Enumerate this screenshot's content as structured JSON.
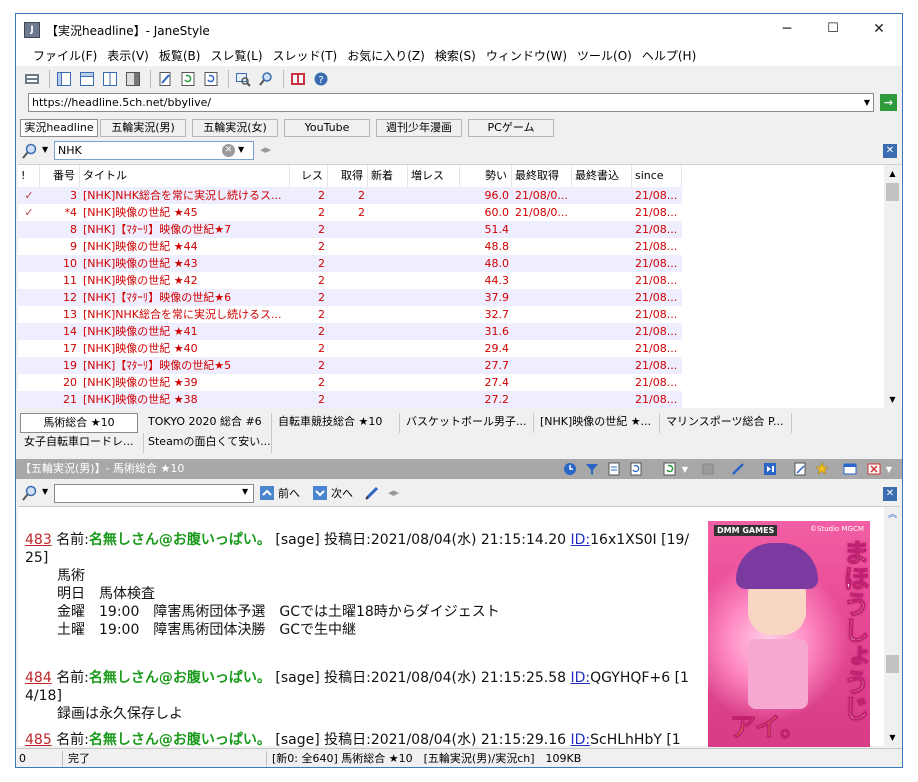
{
  "window": {
    "title": "【実況headline】- JaneStyle",
    "min": "─",
    "max": "☐",
    "close": "✕"
  },
  "menu": [
    "ファイル(F)",
    "表示(V)",
    "板覧(B)",
    "スレ覧(L)",
    "スレッド(T)",
    "お気に入り(Z)",
    "検索(S)",
    "ウィンドウ(W)",
    "ツール(O)",
    "ヘルプ(H)"
  ],
  "address": {
    "url": "https://headline.5ch.net/bbylive/",
    "go": "→"
  },
  "board_tabs": [
    {
      "label": "実況headline",
      "selected": true
    },
    {
      "label": "五輪実況(男)",
      "selected": false
    },
    {
      "label": "五輪実況(女)",
      "selected": false
    },
    {
      "label": "YouTube",
      "selected": false
    },
    {
      "label": "週刊少年漫画",
      "selected": false
    },
    {
      "label": "PCゲーム",
      "selected": false
    }
  ],
  "list_search": {
    "value": "NHK"
  },
  "list": {
    "headers": [
      "!",
      "番号",
      "タイトル",
      "レス",
      "取得",
      "新着",
      "増レス",
      "勢い",
      "最終取得",
      "最終書込",
      "since"
    ],
    "rows": [
      {
        "mark": "✓",
        "no": "3",
        "title": "[NHK]NHK総合を常に実況し続けるス...",
        "res": "2",
        "get": "2",
        "new": "",
        "inc": "",
        "force": "96.0",
        "last_get": "21/08/0...",
        "last_write": "",
        "since": "21/08..."
      },
      {
        "mark": "✓",
        "no": "*4",
        "title": "[NHK]映像の世紀 ★45",
        "res": "2",
        "get": "2",
        "new": "",
        "inc": "",
        "force": "60.0",
        "last_get": "21/08/0...",
        "last_write": "",
        "since": "21/08..."
      },
      {
        "mark": "",
        "no": "8",
        "title": "[NHK]【ﾏﾀｰﾘ】映像の世紀★7",
        "res": "2",
        "get": "",
        "new": "",
        "inc": "",
        "force": "51.4",
        "last_get": "",
        "last_write": "",
        "since": "21/08..."
      },
      {
        "mark": "",
        "no": "9",
        "title": "[NHK]映像の世紀 ★44",
        "res": "2",
        "get": "",
        "new": "",
        "inc": "",
        "force": "48.8",
        "last_get": "",
        "last_write": "",
        "since": "21/08..."
      },
      {
        "mark": "",
        "no": "10",
        "title": "[NHK]映像の世紀 ★43",
        "res": "2",
        "get": "",
        "new": "",
        "inc": "",
        "force": "48.0",
        "last_get": "",
        "last_write": "",
        "since": "21/08..."
      },
      {
        "mark": "",
        "no": "11",
        "title": "[NHK]映像の世紀 ★42",
        "res": "2",
        "get": "",
        "new": "",
        "inc": "",
        "force": "44.3",
        "last_get": "",
        "last_write": "",
        "since": "21/08..."
      },
      {
        "mark": "",
        "no": "12",
        "title": "[NHK]【ﾏﾀｰﾘ】映像の世紀★6",
        "res": "2",
        "get": "",
        "new": "",
        "inc": "",
        "force": "37.9",
        "last_get": "",
        "last_write": "",
        "since": "21/08..."
      },
      {
        "mark": "",
        "no": "13",
        "title": "[NHK]NHK総合を常に実況し続けるス...",
        "res": "2",
        "get": "",
        "new": "",
        "inc": "",
        "force": "32.7",
        "last_get": "",
        "last_write": "",
        "since": "21/08..."
      },
      {
        "mark": "",
        "no": "14",
        "title": "[NHK]映像の世紀 ★41",
        "res": "2",
        "get": "",
        "new": "",
        "inc": "",
        "force": "31.6",
        "last_get": "",
        "last_write": "",
        "since": "21/08..."
      },
      {
        "mark": "",
        "no": "17",
        "title": "[NHK]映像の世紀 ★40",
        "res": "2",
        "get": "",
        "new": "",
        "inc": "",
        "force": "29.4",
        "last_get": "",
        "last_write": "",
        "since": "21/08..."
      },
      {
        "mark": "",
        "no": "19",
        "title": "[NHK]【ﾏﾀｰﾘ】映像の世紀★5",
        "res": "2",
        "get": "",
        "new": "",
        "inc": "",
        "force": "27.7",
        "last_get": "",
        "last_write": "",
        "since": "21/08..."
      },
      {
        "mark": "",
        "no": "20",
        "title": "[NHK]映像の世紀 ★39",
        "res": "2",
        "get": "",
        "new": "",
        "inc": "",
        "force": "27.4",
        "last_get": "",
        "last_write": "",
        "since": "21/08..."
      },
      {
        "mark": "",
        "no": "21",
        "title": "[NHK]映像の世紀 ★38",
        "res": "2",
        "get": "",
        "new": "",
        "inc": "",
        "force": "27.2",
        "last_get": "",
        "last_write": "",
        "since": "21/08..."
      }
    ]
  },
  "thread_tabs": [
    {
      "label": "馬術総合 ★10",
      "selected": true
    },
    {
      "label": "TOKYO 2020 総合 #6",
      "selected": false
    },
    {
      "label": "自転車競技総合 ★10",
      "selected": false
    },
    {
      "label": "バスケットボール男子...",
      "selected": false
    },
    {
      "label": "[NHK]映像の世紀 ★...",
      "selected": false
    },
    {
      "label": "マリンスポーツ総合 P...",
      "selected": false
    },
    {
      "label": "女子自転車ロードレ...",
      "selected": false
    },
    {
      "label": "Steamの面白くて安い...",
      "selected": false
    }
  ],
  "thread_title": "【五輪実況(男)】- 馬術総合 ★10",
  "thread_search": {
    "prev": "前へ",
    "next": "次へ"
  },
  "posts": [
    {
      "num": "483",
      "name_label": "名前:",
      "name": "名無しさん@お腹いっぱい。",
      "mail": "[sage]",
      "date": "投稿日:2021/08/04(水) 21:15:14.20",
      "id_label": "ID:",
      "id": "16x1XS0I",
      "count": "[19/",
      "count2": "25]",
      "body": [
        "馬術",
        "明日　馬体検査",
        "金曜　19:00　障害馬術団体予選　GCでは土曜18時からダイジェスト",
        "土曜　19:00　障害馬術団体決勝　GCで生中継"
      ]
    },
    {
      "num": "484",
      "name_label": "名前:",
      "name": "名無しさん@お腹いっぱい。",
      "mail": "[sage]",
      "date": "投稿日:2021/08/04(水) 21:15:25.58",
      "id_label": "ID:",
      "id": "QGYHQF+6",
      "count": "[1",
      "count2": "4/18]",
      "body": [
        "録画は永久保存しよ"
      ]
    },
    {
      "num": "485",
      "name_label": "名前:",
      "name": "名無しさん@お腹いっぱい。",
      "mail": "[sage]",
      "date": "投稿日:2021/08/04(水) 21:15:29.16",
      "id_label": "ID:",
      "id": "ScHLhHbY",
      "count": "[1",
      "count2": "",
      "body": []
    }
  ],
  "ad": {
    "brand": "DMM GAMES",
    "copy": "©Studio MGCM",
    "title": "まほうしょうじ",
    "sub": "アイ。"
  },
  "status": {
    "left": "0",
    "state": "完了",
    "info": "[新0: 全640] 馬術総合 ★10　[五輪実況(男)/実況ch]　109KB"
  },
  "colors": {
    "accent": "#d00000",
    "name": "#1a9a1a",
    "link": "#2230c0",
    "postnum": "#c0242a"
  }
}
